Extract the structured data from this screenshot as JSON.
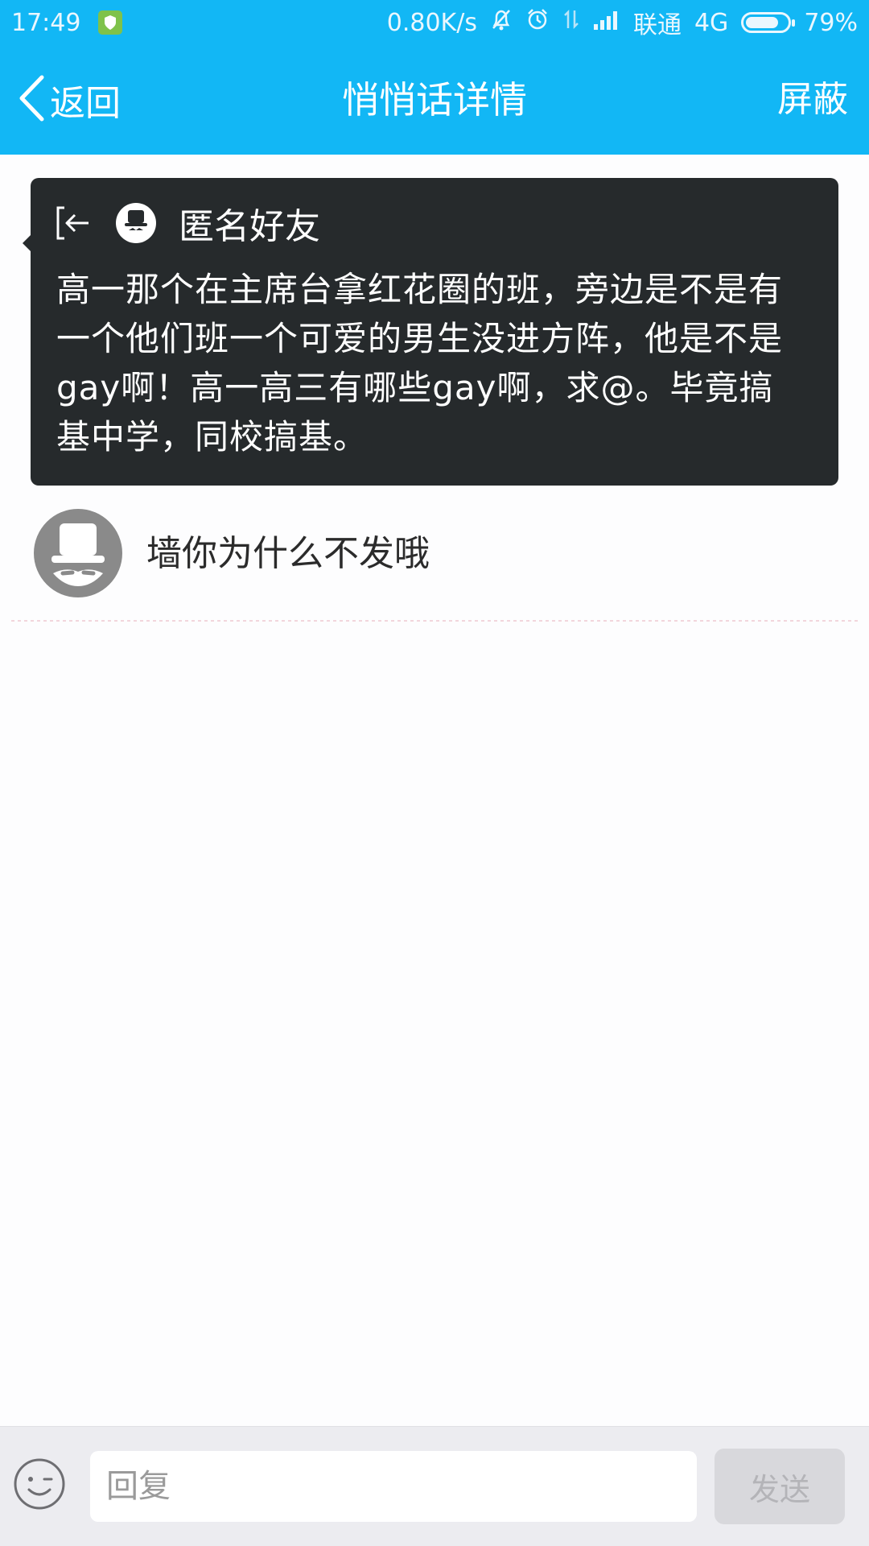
{
  "status_bar": {
    "time": "17:49",
    "network_speed": "0.80K/s",
    "carrier": "联通",
    "network_type": "4G",
    "battery_level": "79%",
    "battery_fraction": 0.79,
    "icons": [
      "shield-icon",
      "bell-off-icon",
      "alarm-icon",
      "data-transfer-icon",
      "signal-icon",
      "battery-icon"
    ]
  },
  "nav": {
    "back_label": "返回",
    "title": "悄悄话详情",
    "block_label": "屏蔽"
  },
  "whisper": {
    "sender": "匿名好友",
    "message": "高一那个在主席台拿红花圈的班，旁边是不是有一个他们班一个可爱的男生没进方阵，他是不是gay啊！高一高三有哪些gay啊，求@。毕竟搞基中学，同校搞基。"
  },
  "reply": {
    "text": "墙你为什么不发哦"
  },
  "input_bar": {
    "placeholder": "回复",
    "send_label": "发送"
  },
  "colors": {
    "header": "#12b7f5",
    "card": "#262a2c",
    "avatar": "#8a8a8a",
    "send_disabled": "#d8d8dc"
  }
}
